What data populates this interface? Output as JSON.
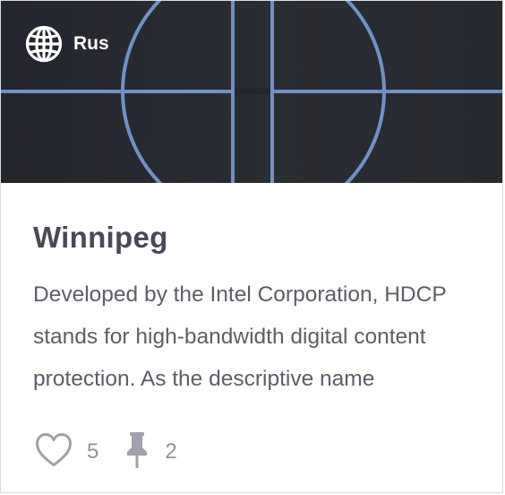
{
  "card": {
    "banner": {
      "language_icon": "globe-icon",
      "language_label": "Rus"
    },
    "title": "Winnipeg",
    "description": "Developed by the Intel Corporation, HDCP stands for high-bandwidth digital content protection. As the descriptive name",
    "likes": {
      "icon": "heart-icon",
      "count": "5"
    },
    "pins": {
      "icon": "pin-icon",
      "count": "2"
    }
  },
  "colors": {
    "banner_background": "#25282e",
    "pattern_line": "#7191c4",
    "title": "#474a57",
    "body_text": "#5b5e6a",
    "meta_text": "#8e919b"
  }
}
